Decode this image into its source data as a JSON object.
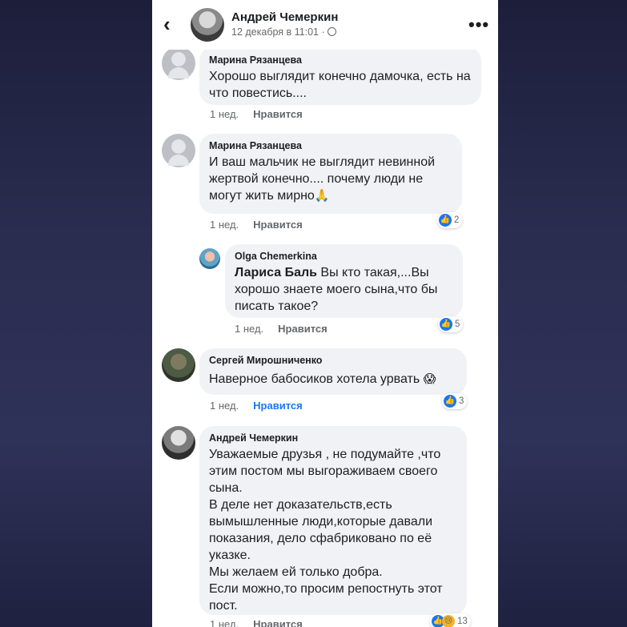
{
  "header": {
    "back_glyph": "‹",
    "name": "Андрей Чемеркин",
    "date": "12 декабря в 11:01 ·",
    "more_glyph": "•••"
  },
  "comments": [
    {
      "author": "Марина Рязанцева",
      "text": "Хорошо выглядит конечно дамочка, есть на что повестись....",
      "time": "1 нед.",
      "like_label": "Нравится",
      "reactions": ""
    },
    {
      "author": "Марина Рязанцева",
      "text": "И ваш мальчик не выглядит невинной жертвой конечно.... почему люди не могут жить мирно",
      "emoji": "🙏",
      "time": "1 нед.",
      "like_label": "Нравится",
      "reactions": "2"
    },
    {
      "author": "Olga Chemerkina",
      "mention": "Лариса Баль",
      "text": " Вы кто такая,...Вы хорошо знаете моего сына,что бы писать такое?",
      "time": "1 нед.",
      "like_label": "Нравится",
      "reactions": "5"
    },
    {
      "author": "Сергей Мирошниченко",
      "text": "Наверное бабосиков хотела урвать ",
      "emoji": "😱",
      "time": "1 нед.",
      "like_label": "Нравится",
      "reactions": "3"
    },
    {
      "author": "Андрей Чемеркин",
      "text_lines": [
        "Уважаемые друзья , не подумайте ,что этим постом мы выгораживаем своего сына.",
        "В деле нет доказательств,есть вымышленные люди,которые давали показания, дело сфабриковано по её указке.",
        "Мы желаем ей только добра.",
        "Если можно,то просим репостнуть этот пост."
      ],
      "time": "1 нед.",
      "like_label": "Нравится",
      "reactions": "13"
    }
  ],
  "colors": {
    "accent": "#1877f2",
    "bubble": "#f0f2f5",
    "meta": "#65676b"
  },
  "icons": {
    "back": "chevron-left-icon",
    "more": "more-dots-icon",
    "globe": "globe-icon",
    "like": "like-thumb-icon",
    "sad": "sad-face-icon"
  }
}
